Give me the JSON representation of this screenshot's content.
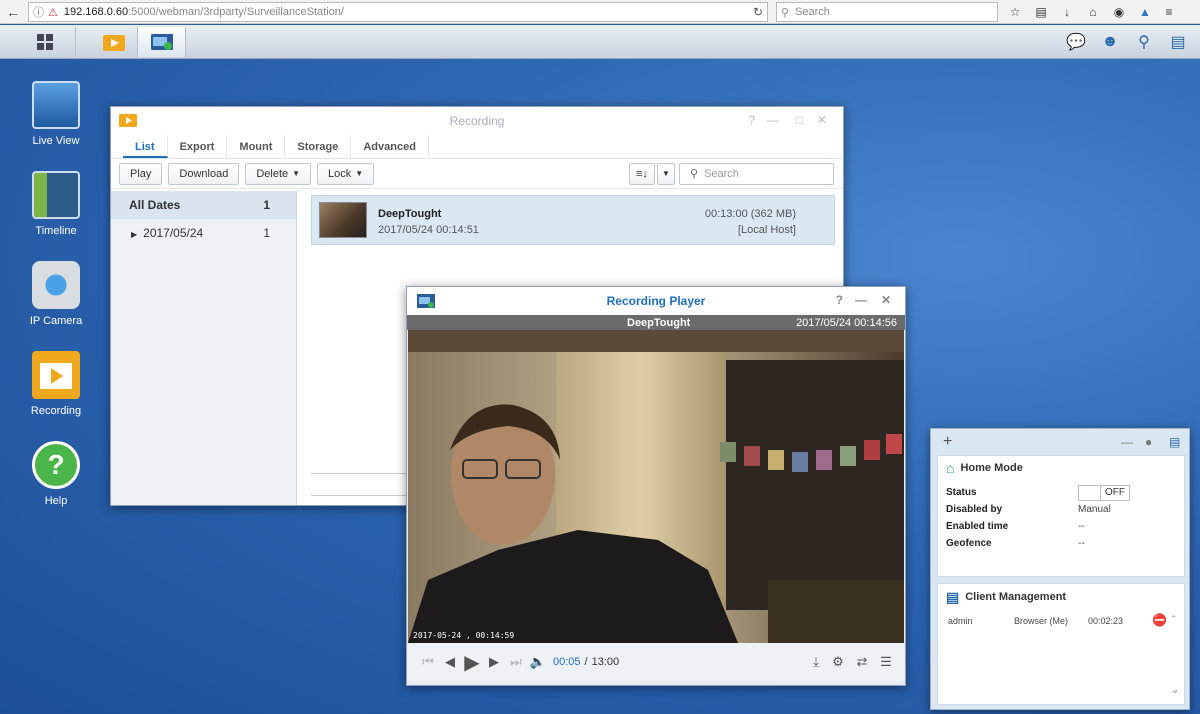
{
  "browser": {
    "url_prefix": "192.168.0.60",
    "url_rest": ":5000/webman/3rdparty/SurveillanceStation/",
    "search_placeholder": "Search"
  },
  "desktop_icons": [
    {
      "label": "Live View",
      "icon": "live-view-icon"
    },
    {
      "label": "Timeline",
      "icon": "timeline-icon"
    },
    {
      "label": "IP Camera",
      "icon": "ip-camera-icon"
    },
    {
      "label": "Recording",
      "icon": "recording-icon"
    },
    {
      "label": "Help",
      "icon": "help-icon"
    }
  ],
  "recording": {
    "title": "Recording",
    "tabs": [
      "List",
      "Export",
      "Mount",
      "Storage",
      "Advanced"
    ],
    "buttons": {
      "play": "Play",
      "download": "Download",
      "delete": "Delete",
      "lock": "Lock"
    },
    "search_placeholder": "Search",
    "sidebar": [
      {
        "label": "All Dates",
        "count": "1"
      },
      {
        "label": "2017/05/24",
        "count": "1"
      }
    ],
    "item": {
      "name": "DeepTought",
      "datetime": "2017/05/24 00:14:51",
      "duration": "00:13:00 (362 MB)",
      "host": "[Local Host]"
    }
  },
  "player": {
    "title": "Recording Player",
    "camera": "DeepTought",
    "timestamp": "2017/05/24 00:14:56",
    "overlay": "2017-05-24 , 00:14:59",
    "current": "00:05",
    "separator": "/",
    "total": "13:00"
  },
  "widget": {
    "home_mode": {
      "title": "Home Mode",
      "rows": [
        {
          "key": "Status",
          "value": ""
        },
        {
          "key": "Disabled by",
          "value": "Manual"
        },
        {
          "key": "Enabled time",
          "value": "--"
        },
        {
          "key": "Geofence",
          "value": "--"
        }
      ],
      "toggle": "OFF"
    },
    "client": {
      "title": "Client Management",
      "user": "admin",
      "client": "Browser (Me)",
      "time": "00:02:23"
    }
  },
  "colors": {
    "accent": "#1f6fbf",
    "desktop": "#2d66b2"
  }
}
